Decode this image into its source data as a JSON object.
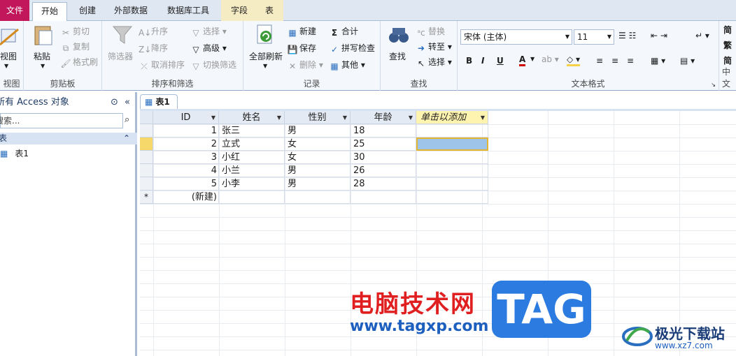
{
  "tabs": {
    "file": "文件",
    "home": "开始",
    "create": "创建",
    "external": "外部数据",
    "dbtools": "数据库工具",
    "fields": "字段",
    "table": "表"
  },
  "ribbon": {
    "view": {
      "label": "视图",
      "group": "视图"
    },
    "clipboard": {
      "paste": "粘贴",
      "cut": "剪切",
      "copy": "复制",
      "format_painter": "格式刷",
      "group": "剪贴板"
    },
    "sort": {
      "filter": "筛选器",
      "asc": "升序",
      "desc": "降序",
      "clear_sort": "取消排序",
      "selection": "选择",
      "advanced": "高级",
      "toggle_filter": "切换筛选",
      "group": "排序和筛选"
    },
    "records": {
      "refresh": "全部刷新",
      "new": "新建",
      "save": "保存",
      "delete": "删除",
      "totals": "合计",
      "spelling": "拼写检查",
      "more": "其他",
      "group": "记录"
    },
    "find": {
      "find": "查找",
      "replace": "替换",
      "goto": "转至",
      "select": "选择",
      "group": "查找"
    },
    "text": {
      "font": "宋体 (主体)",
      "size": "11",
      "group": "文本格式"
    },
    "cut_group": "中文",
    "right1": "简",
    "right2": "繁",
    "right3": "简"
  },
  "nav": {
    "header": "所有 Access 对象",
    "search_placeholder": "搜索...",
    "category": "表",
    "item": "表1"
  },
  "document": {
    "tab": "表1",
    "columns": [
      "ID",
      "姓名",
      "性别",
      "年龄",
      "单击以添加"
    ],
    "rows": [
      [
        "1",
        "张三",
        "男",
        "18"
      ],
      [
        "2",
        "立式",
        "女",
        "25"
      ],
      [
        "3",
        "小红",
        "女",
        "30"
      ],
      [
        "4",
        "小兰",
        "男",
        "26"
      ],
      [
        "5",
        "小李",
        "男",
        "28"
      ]
    ],
    "new_row": "(新建)",
    "new_marker": "*"
  },
  "watermark": {
    "cn": "电脑技术网",
    "url": "www.tagxp.com",
    "tag": "TAG",
    "site": "极光下载站",
    "site_url": "www.xz7.com"
  },
  "colors": {
    "file_tab": "#c2185b",
    "context_tab": "#f6ecc4",
    "selected_cell": "#9ec4ea",
    "add_col": "#fff3b0"
  }
}
